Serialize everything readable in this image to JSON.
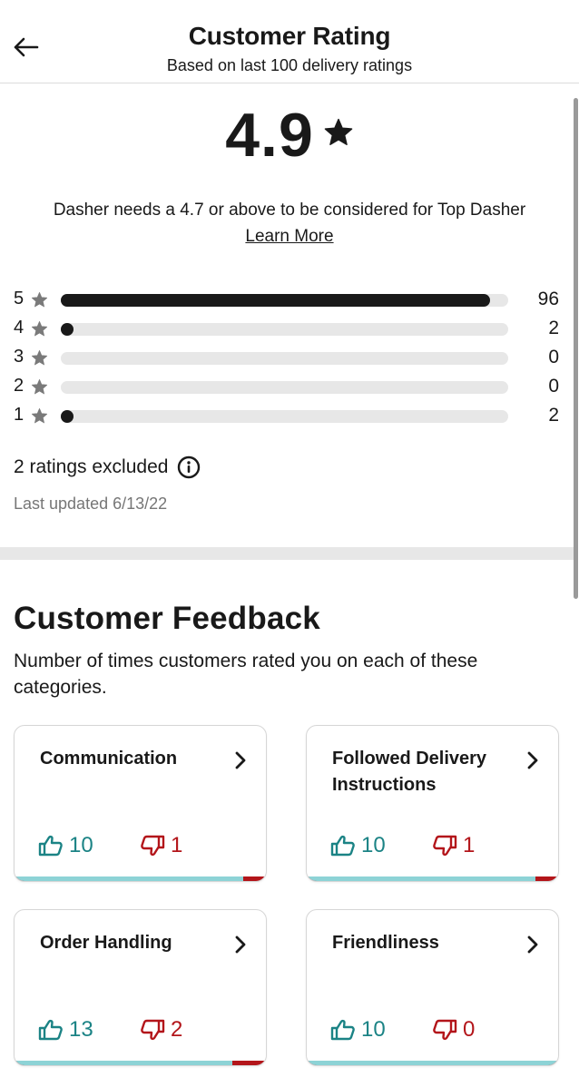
{
  "header": {
    "title": "Customer Rating",
    "subtitle": "Based on last 100 delivery ratings",
    "back_icon": "arrow-left-icon"
  },
  "summary": {
    "rating": "4.9",
    "star_icon": "star-icon",
    "threshold_text": "Dasher needs a 4.7 or above to be considered for Top Dasher",
    "learn_more": "Learn More"
  },
  "distribution": {
    "total": 100,
    "rows": [
      {
        "stars": "5",
        "count": "96",
        "value": 96
      },
      {
        "stars": "4",
        "count": "2",
        "value": 2
      },
      {
        "stars": "3",
        "count": "0",
        "value": 0
      },
      {
        "stars": "2",
        "count": "0",
        "value": 0
      },
      {
        "stars": "1",
        "count": "2",
        "value": 2
      }
    ]
  },
  "excluded": {
    "text": "2 ratings excluded",
    "icon": "info-icon"
  },
  "last_updated": "Last updated 6/13/22",
  "feedback": {
    "title": "Customer Feedback",
    "subtitle": "Number of times customers rated you on each of these categories.",
    "colors": {
      "positive": "#1b8385",
      "negative": "#b3151a",
      "positive_bar": "#8dd3d6"
    },
    "cards": [
      {
        "title": "Communication",
        "up": "10",
        "down": "1",
        "up_value": 10,
        "down_value": 1
      },
      {
        "title": "Followed Delivery Instructions",
        "up": "10",
        "down": "1",
        "up_value": 10,
        "down_value": 1
      },
      {
        "title": "Order Handling",
        "up": "13",
        "down": "2",
        "up_value": 13,
        "down_value": 2
      },
      {
        "title": "Friendliness",
        "up": "10",
        "down": "0",
        "up_value": 10,
        "down_value": 0
      }
    ]
  }
}
